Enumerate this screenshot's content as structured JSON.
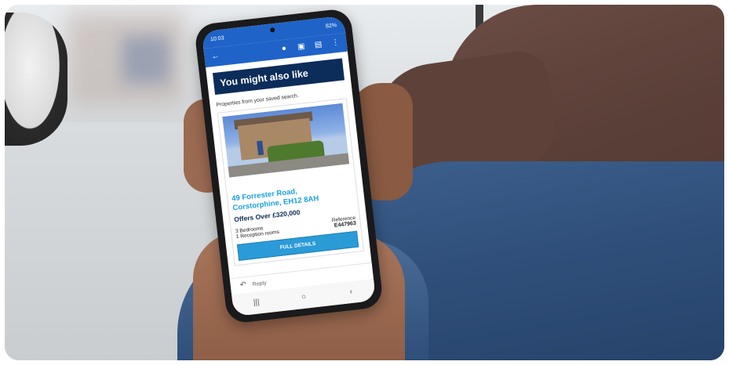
{
  "status_bar": {
    "time": "10:03",
    "battery": "82%"
  },
  "email": {
    "banner_title": "You might also like",
    "subtitle": "Properties from your saved search.",
    "listing": {
      "address_line1": "49 Forrester Road,",
      "address_line2": "Corstorphine, EH12 8AH",
      "price": "Offers Over £320,000",
      "bedrooms": "3 Bedrooms",
      "reception_rooms": "1 Reception rooms",
      "reference_label": "Reference",
      "reference_value": "E447963",
      "button_label": "FULL DETAILS"
    },
    "reply_label": "Reply"
  },
  "colors": {
    "banner": "#0c2c5a",
    "address": "#1aa0e0",
    "button": "#2b9bd8",
    "app_bar": "#1f63c8"
  },
  "icons": [
    "back-arrow-icon",
    "microphone-icon",
    "delete-icon",
    "archive-icon",
    "more-icon",
    "reply-icon",
    "recent-apps-icon",
    "home-icon",
    "back-nav-icon"
  ]
}
